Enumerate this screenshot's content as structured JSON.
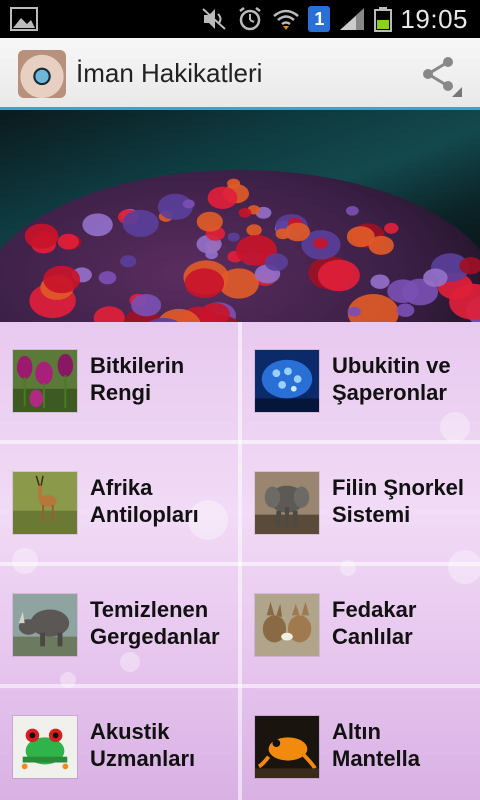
{
  "status_bar": {
    "time": "19:05",
    "notification_badge": "1",
    "icons": [
      "gallery-icon",
      "mute-icon",
      "alarm-icon",
      "wifi-icon",
      "signal-icon",
      "battery-icon"
    ]
  },
  "action_bar": {
    "title": "İman Hakikatleri",
    "accent_color": "#3aa3d6"
  },
  "tiles": [
    {
      "label": "Bitkilerin\nRengi",
      "thumb": "tulips-thumbnail"
    },
    {
      "label": "Ubukitin ve\nŞaperonlar",
      "thumb": "molecule-thumbnail"
    },
    {
      "label": "Afrika\nAntilopları",
      "thumb": "antelope-thumbnail"
    },
    {
      "label": "Filin Şnorkel\nSistemi",
      "thumb": "elephant-thumbnail"
    },
    {
      "label": "Temizlenen\nGergedanlar",
      "thumb": "rhino-thumbnail"
    },
    {
      "label": "Fedakar\nCanlılar",
      "thumb": "jackals-thumbnail"
    },
    {
      "label": "Akustik\nUzmanları",
      "thumb": "tree-frog-thumbnail"
    },
    {
      "label": "Altın\nMantella",
      "thumb": "golden-frog-thumbnail"
    }
  ]
}
